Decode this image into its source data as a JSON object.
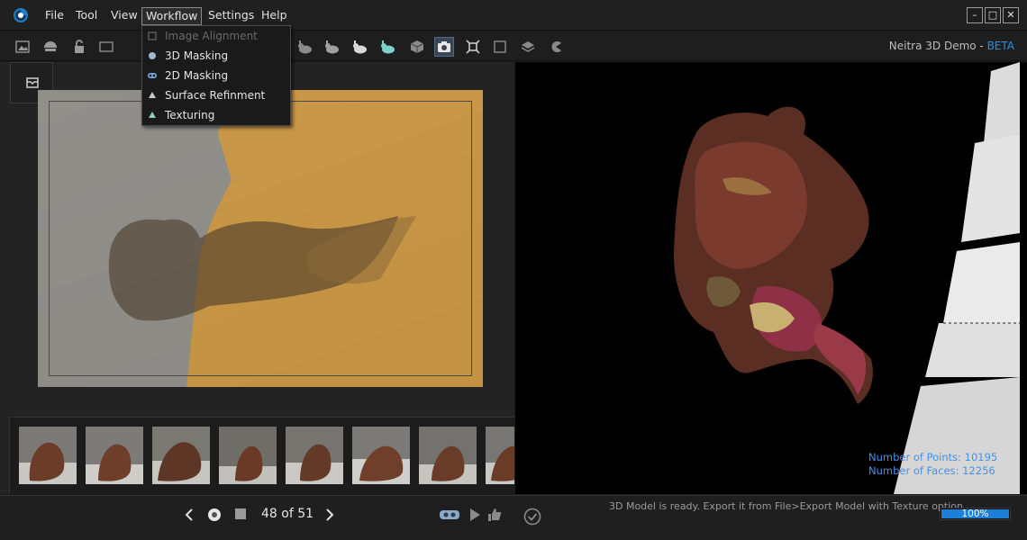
{
  "menubar": {
    "items": [
      "File",
      "Tool",
      "View",
      "Workflow",
      "Settings",
      "Help"
    ],
    "active": "Workflow",
    "window_controls": [
      "–",
      "□",
      "✕"
    ]
  },
  "toolbar": {
    "icons": [
      "image-icon",
      "camera-pose-icon",
      "lock-icon",
      "rabbit-icon",
      "rabbit-icon",
      "rabbit-icon",
      "rabbit-icon",
      "rabbit-icon",
      "cube-icon",
      "camera-icon",
      "crosshair-icon",
      "square-icon",
      "layers-icon",
      "pacman-icon"
    ],
    "brand": "Neitra 3D Demo - ",
    "brand_badge": "BETA"
  },
  "workflow_menu": {
    "items": [
      {
        "label": "Image Alignment",
        "enabled": false
      },
      {
        "label": "3D Masking",
        "enabled": true
      },
      {
        "label": "2D Masking",
        "enabled": true
      },
      {
        "label": "Surface Refinment",
        "enabled": true
      },
      {
        "label": "Texturing",
        "enabled": true
      }
    ]
  },
  "filmstrip": {
    "thumb_count": 8
  },
  "navigation": {
    "current": 48,
    "total": 51,
    "page_label": "48 of 51",
    "prev_icon": "chevron-left-icon",
    "next_icon": "chevron-right-icon"
  },
  "viewport": {
    "points_label": "Number of Points: 10195",
    "faces_label": "Number of Faces: 12256"
  },
  "status": {
    "message": "3D Model is ready. Export it from File>Export Model with Texture option.",
    "progress_percent": 100,
    "progress_label": "100%"
  },
  "colors": {
    "accent": "#2e8fe0",
    "mask_overlay": "#e0a33a",
    "stats_text": "#4a90e2",
    "progress_fill": "#1e7fd6"
  }
}
